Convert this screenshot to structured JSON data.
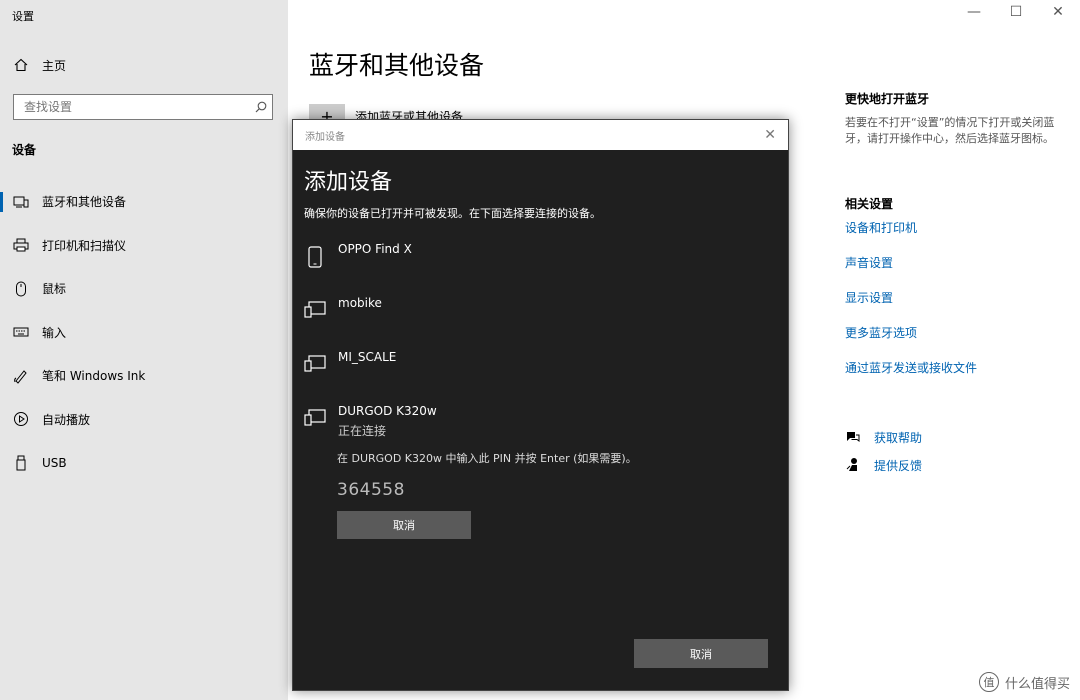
{
  "app": {
    "title": "设置"
  },
  "window_controls": {
    "minimize": "—",
    "maximize": "☐",
    "close": "✕"
  },
  "sidebar": {
    "home_label": "主页",
    "search_placeholder": "查找设置",
    "section_title": "设备",
    "items": [
      {
        "label": "蓝牙和其他设备",
        "icon": "bluetooth-devices-icon",
        "active": true
      },
      {
        "label": "打印机和扫描仪",
        "icon": "printer-icon"
      },
      {
        "label": "鼠标",
        "icon": "mouse-icon"
      },
      {
        "label": "输入",
        "icon": "keyboard-icon"
      },
      {
        "label": "笔和 Windows Ink",
        "icon": "pen-icon"
      },
      {
        "label": "自动播放",
        "icon": "autoplay-icon"
      },
      {
        "label": "USB",
        "icon": "usb-icon"
      }
    ]
  },
  "main": {
    "title": "蓝牙和其他设备",
    "add_label": "添加蓝牙或其他设备",
    "add_icon": "+"
  },
  "right_panel": {
    "quick_title": "更快地打开蓝牙",
    "quick_desc": "若要在不打开“设置”的情况下打开或关闭蓝牙，请打开操作中心，然后选择蓝牙图标。",
    "related_title": "相关设置",
    "links": [
      "设备和打印机",
      "声音设置",
      "显示设置",
      "更多蓝牙选项",
      "通过蓝牙发送或接收文件"
    ],
    "help": "获取帮助",
    "feedback": "提供反馈"
  },
  "dialog": {
    "window_title": "添加设备",
    "close": "✕",
    "heading": "添加设备",
    "subtitle": "确保你的设备已打开并可被发现。在下面选择要连接的设备。",
    "devices": [
      {
        "name": "OPPO Find X",
        "icon": "phone-icon"
      },
      {
        "name": "mobike",
        "icon": "device-icon"
      },
      {
        "name": "MI_SCALE",
        "icon": "device-icon"
      },
      {
        "name": "DURGOD K320w",
        "status": "正在连接",
        "icon": "device-icon"
      }
    ],
    "pin_prompt": "在 DURGOD K320w 中输入此 PIN 并按 Enter (如果需要)。",
    "pin": "364558",
    "cancel_inline": "取消",
    "cancel_main": "取消"
  },
  "watermark": {
    "logo": "值",
    "text": "什么值得买"
  }
}
